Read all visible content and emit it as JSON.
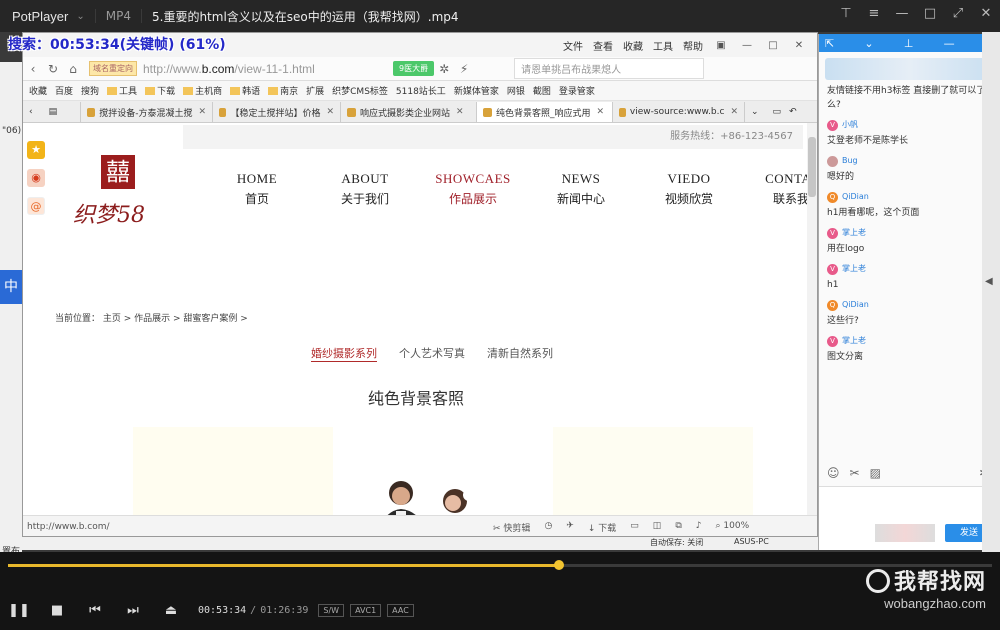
{
  "player": {
    "brand": "PotPlayer",
    "format": "MP4",
    "file_title": "5.重要的html含义以及在seo中的运用（我帮找网）.mp4",
    "overlay": "搜索：00:53:34(关键帧) (61%)",
    "current_time": "00:53:34",
    "separator": "/",
    "duration": "01:26:39",
    "tags": [
      "S/W",
      "AVC1",
      "AAC"
    ],
    "progress": 0.56
  },
  "browser": {
    "menu": [
      "文件",
      "查看",
      "收藏",
      "工具",
      "帮助"
    ],
    "badge": "域名重定向",
    "url_prefix": "http://www.",
    "url_host": "b.com",
    "url_path": "/view-11-1.html",
    "safe_btn": "9医大爵",
    "search_placeholder": "请恩单挑吕布战果熄人",
    "bookmarks": [
      "收藏",
      "百度",
      "搜狗",
      "工具",
      "下载",
      "主机商",
      "韩语",
      "南京",
      "扩展",
      "织梦CMS标签",
      "5118站长工",
      "新媒体管家",
      "网银",
      "截图",
      "登录管家"
    ],
    "tabs": [
      "搅拌设备-方泰混凝土搅",
      "【稳定土搅拌站】价格",
      "响应式摄影类企业网站",
      "纯色背景客照_响应式用",
      "view-source:www.b.c"
    ],
    "status_url": "http://www.b.com/",
    "status_tools": [
      "快剪辑",
      "下载",
      "100%"
    ]
  },
  "site": {
    "hotline": "服务热线：+86-123-4567",
    "logo_char": "囍",
    "logo_text": "织梦58",
    "nav": [
      {
        "en": "HOME",
        "cn": "首页"
      },
      {
        "en": "ABOUT",
        "cn": "关于我们"
      },
      {
        "en": "SHOWCAES",
        "cn": "作品展示"
      },
      {
        "en": "NEWS",
        "cn": "新闻中心"
      },
      {
        "en": "VIEDO",
        "cn": "视频欣赏"
      },
      {
        "en": "CONTACT",
        "cn": "联系我们"
      }
    ],
    "breadcrumb": "当前位置： 主页 > 作品展示 > 甜蜜客户案例 >",
    "categories": [
      "婚纱摄影系列",
      "个人艺术写真",
      "清新自然系列"
    ],
    "section_title": "纯色背景客照"
  },
  "chat": {
    "messages": [
      {
        "name": "",
        "text": "友情链接不用h3标签  直接删了就可以了么?"
      },
      {
        "name": "小帆",
        "text": "艾登老师不是陈学长"
      },
      {
        "name": "Bug",
        "text": "嗯好的"
      },
      {
        "name": "QiDian",
        "text": "h1用看哪呢，这个页面"
      },
      {
        "name": "掌上老",
        "text": "用在logo"
      },
      {
        "name": "掌上老",
        "text": "h1"
      },
      {
        "name": "QiDian",
        "text": "这些行?"
      },
      {
        "name": "掌上老",
        "text": "图文分离"
      }
    ],
    "send": "发送"
  },
  "desktop": {
    "left_text": "\"06)",
    "left_label": "中",
    "left_bottom": "置布",
    "autosave": "自动保存: 关闭",
    "pc_name": "ASUS-PC"
  },
  "watermark": {
    "cn": "我帮找网",
    "en": "wobangzhao.com"
  },
  "colors": {
    "accent": "#e8b82c",
    "chat_blue": "#2a8ee8",
    "brand_red": "#9b1d1d"
  }
}
